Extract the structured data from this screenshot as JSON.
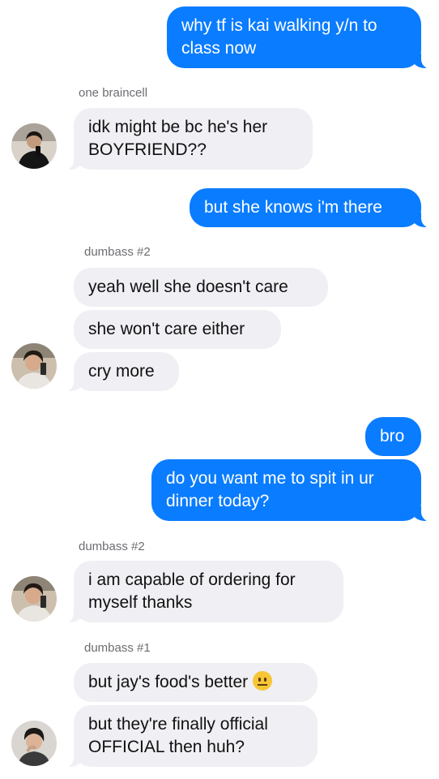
{
  "messages": [
    {
      "text": "why tf is kai walking y/n to class now"
    },
    {
      "text": "idk might be bc he's her BOYFRIEND??"
    },
    {
      "text": "but she knows i'm there"
    },
    {
      "text": "yeah well she doesn't care"
    },
    {
      "text": "she won't care either"
    },
    {
      "text": "cry more"
    },
    {
      "text": "bro"
    },
    {
      "text": "do you want me to spit in ur dinner today?"
    },
    {
      "text": "i am capable of ordering for myself thanks"
    },
    {
      "text": "but jay's food's better"
    },
    {
      "text": "but they're finally official OFFICIAL then huh?"
    }
  ],
  "senders": {
    "one_braincell": "one braincell",
    "dumbass2_a": "dumbass #2",
    "dumbass2_b": "dumbass #2",
    "dumbass1": "dumbass #1"
  },
  "emoji": "neutral-face-emoji",
  "colors": {
    "outgoing": "#0a7cff",
    "incoming": "#efeff4",
    "sender_label": "#6d6d72"
  }
}
